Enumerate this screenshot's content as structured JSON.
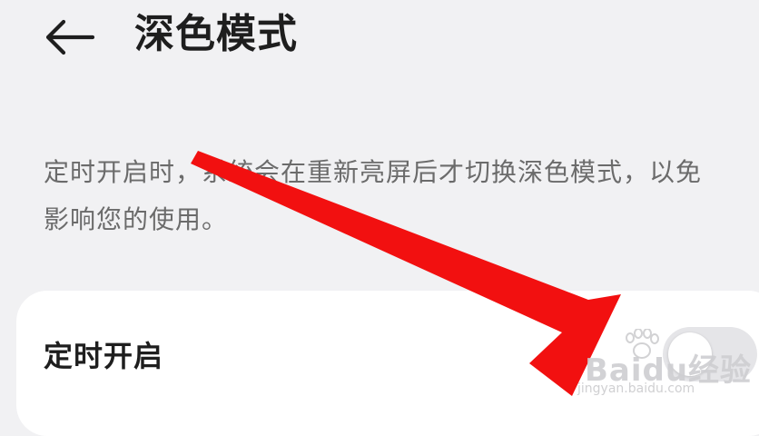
{
  "header": {
    "title": "深色模式"
  },
  "description": "定时开启时，系统会在重新亮屏后才切换深色模式，以免影响您的使用。",
  "settings": {
    "scheduled": {
      "label": "定时开启",
      "enabled": false
    }
  },
  "icons": {
    "back": "arrow-left-icon"
  },
  "colors": {
    "background": "#f1f1f3",
    "card": "#ffffff",
    "annotation_arrow": "#f21010",
    "toggle_off": "#e5e5e8"
  },
  "watermark": {
    "brand": "Baidu经验",
    "url": "jingyan.baidu.com"
  }
}
